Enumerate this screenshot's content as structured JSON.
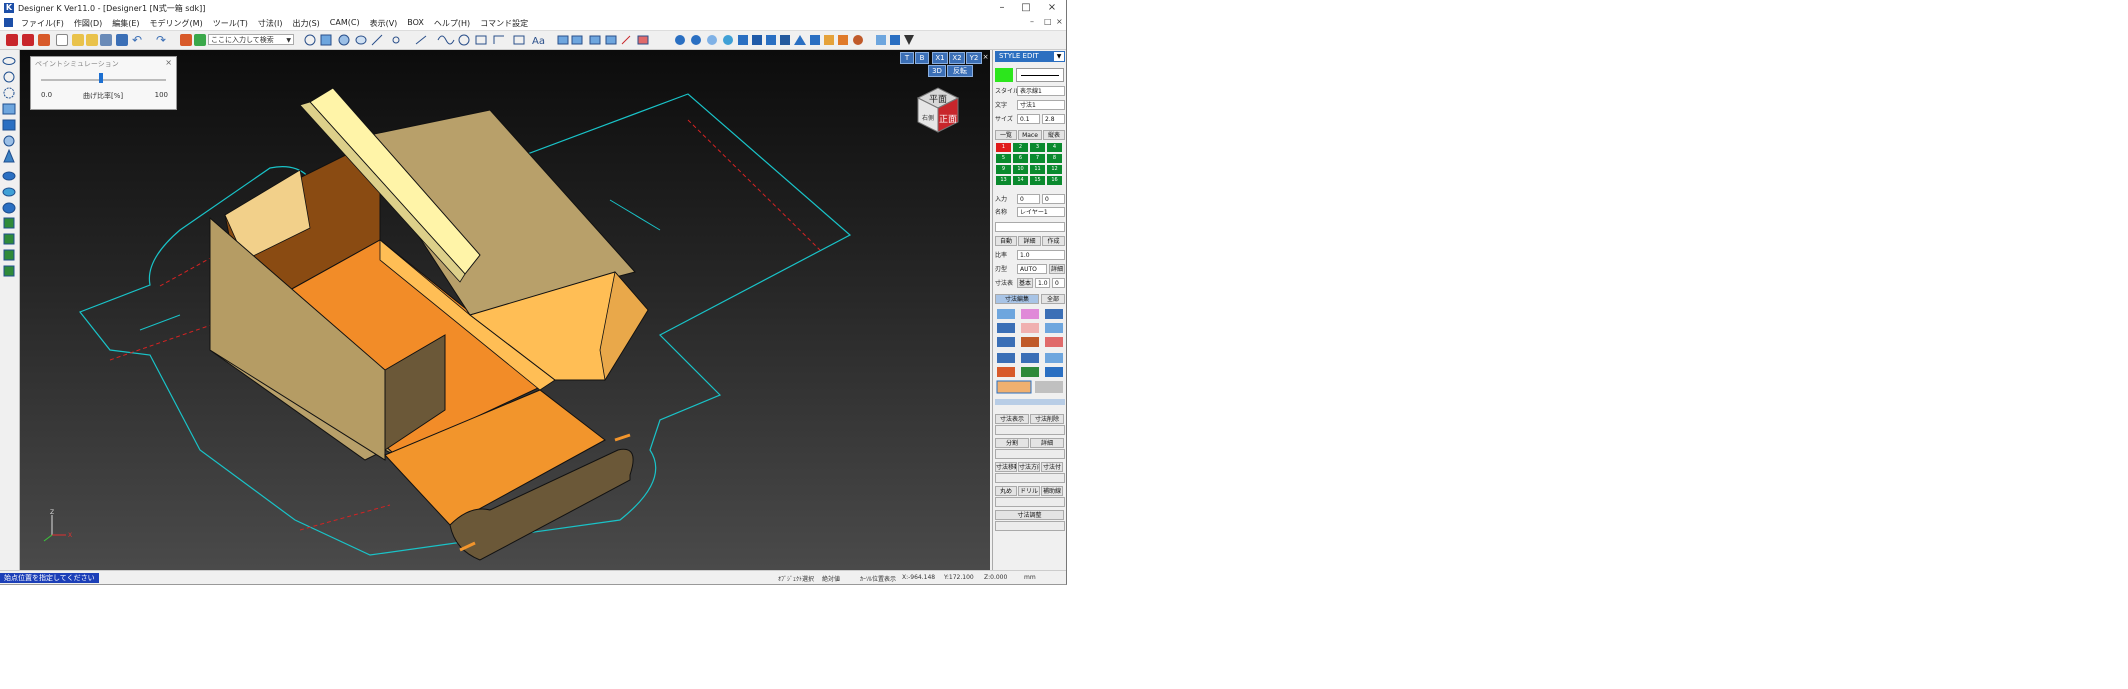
{
  "window": {
    "title": "Designer K Ver11.0 - [Designer1 [N式一箱 sdk]]",
    "logo": "K",
    "controls": [
      "–",
      "□",
      "×"
    ],
    "mdi_controls": [
      "–",
      "□",
      "×"
    ]
  },
  "menu": {
    "items": [
      "ファイル(F)",
      "作図(D)",
      "編集(E)",
      "モデリング(M)",
      "ツール(T)",
      "寸法(I)",
      "出力(S)",
      "CAM(C)",
      "表示(V)",
      "BOX",
      "ヘルプ(H)",
      "コマンド設定"
    ]
  },
  "toolbar": {
    "command_placeholder": "ここに入力して検索",
    "icons": [
      "save-icon",
      "brush-icon",
      "pen-icon",
      "new-file-icon",
      "open-icon",
      "open2-icon",
      "print-icon",
      "save2-icon",
      "undo-icon",
      "redo-icon",
      "layers-icon",
      "grid-icon"
    ]
  },
  "simulation": {
    "title": "ペイントシミュレーション",
    "min": "0.0",
    "max": "100",
    "label": "曲げ比率[%]",
    "value_percent": 48
  },
  "view_buttons": {
    "row1": [
      "T",
      "B",
      "X1",
      "X2",
      "Y2",
      "×"
    ],
    "row2": [
      "3D",
      "反転"
    ]
  },
  "viewcube": {
    "top": "平面",
    "front": "正面",
    "side": "右側"
  },
  "axis": {
    "z": "Z",
    "x": "X"
  },
  "panel": {
    "header": "STYLE EDIT",
    "line_color": "#2ce61c",
    "rows": [
      {
        "label": "スタイル",
        "value": "表示線1"
      },
      {
        "label": "文字",
        "value": "寸法1"
      },
      {
        "label": "サイズ",
        "value": "0.1",
        "value2": "2.8"
      }
    ],
    "tabs": [
      "一覧",
      "Mace",
      "縦表"
    ],
    "grid": [
      "1",
      "2",
      "3",
      "4",
      "5",
      "6",
      "7",
      "8",
      "9",
      "10",
      "11",
      "12",
      "13",
      "14",
      "15",
      "16"
    ],
    "row_input": {
      "label": "入力",
      "value": "0",
      "value2": "0"
    },
    "row_name": {
      "label": "名称",
      "value": "レイヤー1"
    },
    "buttons1": [
      "自動",
      "詳細",
      "作成"
    ],
    "row_kind": {
      "label": "比率",
      "value": "1.0"
    },
    "row_cut": {
      "label": "刃型",
      "value": "AUTO",
      "extra": "詳細"
    },
    "row_dim": {
      "label": "寸法表",
      "value": "基本",
      "value2": "1.0",
      "value3": "0"
    },
    "tab_active": "寸法編集",
    "tab_other": "全部",
    "sections": [
      [
        "寸法表示",
        "寸法削除"
      ],
      [
        "分割",
        "詳細"
      ],
      [
        "寸法移動",
        "寸法方向",
        "寸法付"
      ],
      [
        "丸め",
        "ドリル",
        "補助線"
      ],
      [
        "寸法調整"
      ]
    ]
  },
  "status": {
    "prompt": "始点位置を指定してください",
    "fields": [
      "ｵﾌﾞｼﾞｪｸﾄ選択",
      "絶対値",
      "ｶｰｿﾙ位置表示",
      "X:-964.148",
      "Y:172.100",
      "Z:0.000",
      "mm"
    ]
  },
  "colors": {
    "cutline": "#19c3c8",
    "creaseline": "#d82222",
    "box_outer": "#b8a06a",
    "box_inner": "#f28c28",
    "lid": "#fff4a8",
    "highlight": "#2c6fc0"
  }
}
